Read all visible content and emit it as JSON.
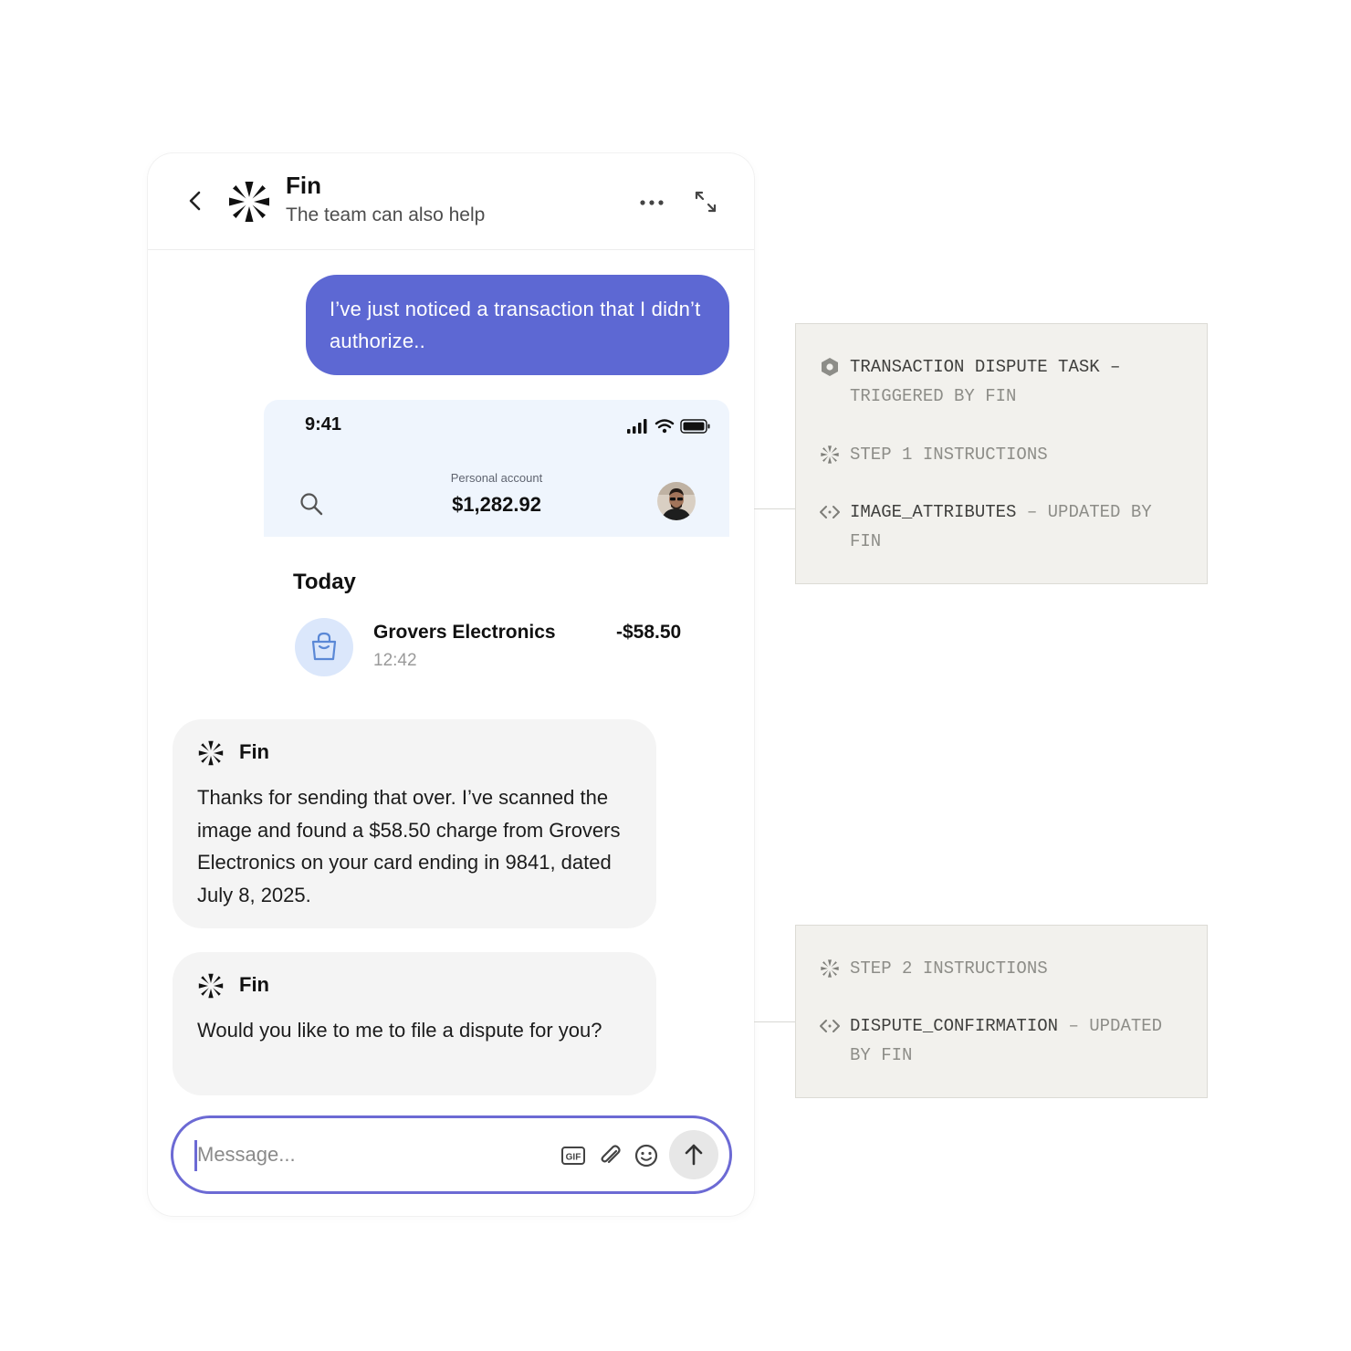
{
  "header": {
    "title": "Fin",
    "subtitle": "The team can also help"
  },
  "user_message": "I’ve just noticed a transaction that I didn’t authorize..",
  "phone_screenshot": {
    "time": "9:41",
    "account_label": "Personal account",
    "balance": "$1,282.92",
    "section_heading": "Today",
    "transaction": {
      "merchant": "Grovers Electronics",
      "time": "12:42",
      "amount": "-$58.50"
    }
  },
  "fin_messages": [
    {
      "sender": "Fin",
      "text": "Thanks for sending that over. I’ve scanned the image and found a $58.50 charge from Grovers Electronics on your card ending in 9841, dated July 8, 2025."
    },
    {
      "sender": "Fin",
      "text": "Would you like to me to file a dispute for you?"
    }
  ],
  "composer": {
    "placeholder": "Message..."
  },
  "panels": [
    {
      "rows": [
        {
          "icon": "hexagon-task-icon",
          "primary": "TRANSACTION DISPUTE TASK –",
          "secondary": "TRIGGERED BY FIN"
        },
        {
          "icon": "fin-logo-icon",
          "primary": "",
          "secondary": "STEP 1 INSTRUCTIONS"
        },
        {
          "icon": "code-brackets-icon",
          "primary": "IMAGE_ATTRIBUTES",
          "secondary": " – UPDATED BY FIN"
        }
      ]
    },
    {
      "rows": [
        {
          "icon": "fin-logo-icon",
          "primary": "",
          "secondary": "STEP 2 INSTRUCTIONS"
        },
        {
          "icon": "code-brackets-icon",
          "primary": "DISPUTE_CONFIRMATION",
          "secondary": " – UPDATED BY FIN"
        }
      ]
    }
  ],
  "colors": {
    "accent": "#5d68d3",
    "composer_border": "#6c6ad4",
    "phone_card_bg": "#eff5fd",
    "bubble_bg": "#f4f4f4",
    "panel_bg": "#f2f1ed"
  }
}
